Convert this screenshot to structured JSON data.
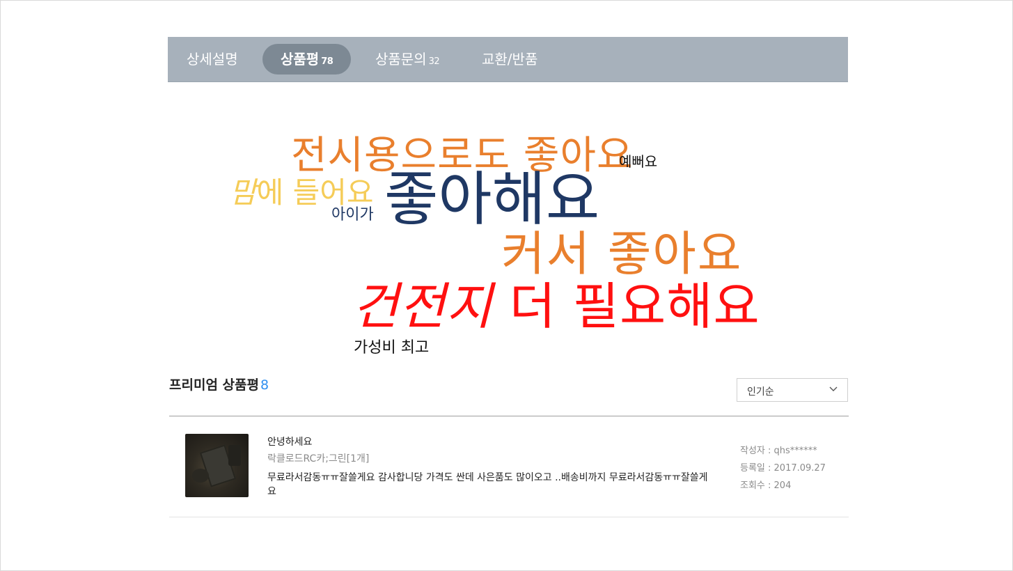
{
  "tabs": [
    {
      "label": "상세설명",
      "count": ""
    },
    {
      "label": "상품평",
      "count": "78"
    },
    {
      "label": "상품문의",
      "count": "32"
    },
    {
      "label": "교환/반품",
      "count": ""
    }
  ],
  "word_cloud": {
    "words": [
      {
        "text": "전시용으로도 좋아요",
        "color": "#e97f2d"
      },
      {
        "text": "예뻐요",
        "color": "#111111"
      },
      {
        "text_italic": "맘",
        "text": "에 들어요",
        "color": "#f5cc58"
      },
      {
        "text": "좋아해요",
        "color": "#1f3864"
      },
      {
        "text": "아이가",
        "color": "#1f3864"
      },
      {
        "text": "커서 좋아요",
        "color": "#e97f2d"
      },
      {
        "text_italic": "건전지",
        "text": " 더 필요해요",
        "color": "#ff1010"
      },
      {
        "text": "가성비 최고",
        "color": "#111111"
      }
    ]
  },
  "premium": {
    "title": "프리미엄 상품평",
    "count": "8",
    "sort_selected": "인기순",
    "accent_color": "#2f8ff0"
  },
  "review": {
    "title": "안녕하세요",
    "option": "락클로드RC카;그린[1개]",
    "body": "무료라서감동ㅠㅠ잘쓸게요 감사합니당 가격도 싼데 사은품도 많이오고 ..배송비까지 무료라서감동ㅠㅠ잘쓸게요",
    "author": "작성자 : qhs******",
    "date": "등록일 : 2017.09.27",
    "views": "조회수 : 204"
  }
}
